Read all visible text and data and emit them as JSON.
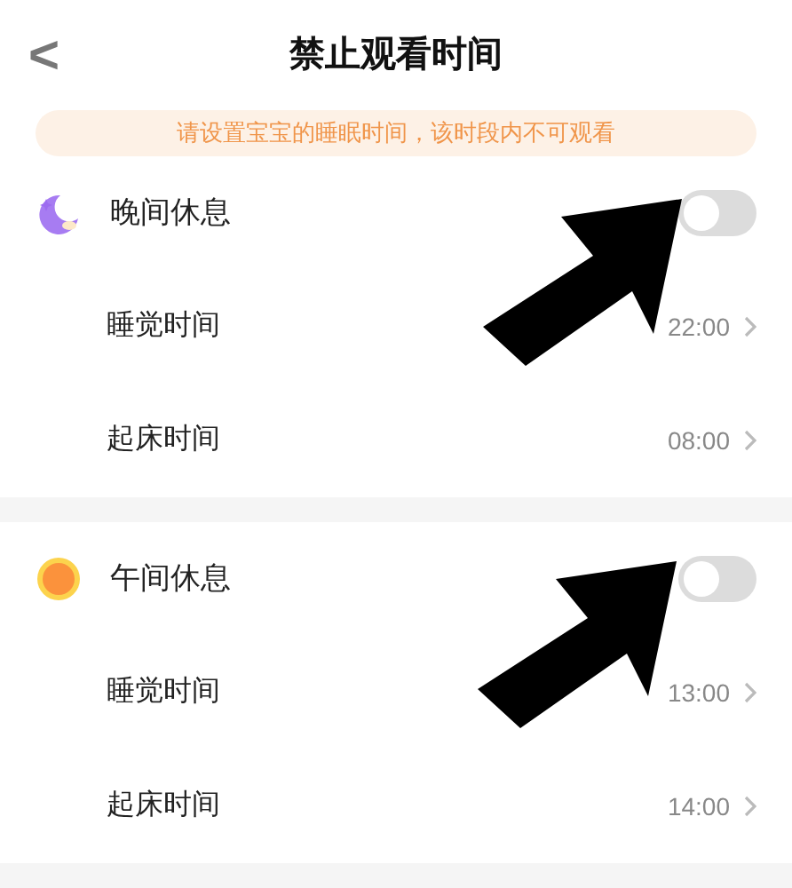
{
  "header": {
    "back": "<",
    "title": "禁止观看时间"
  },
  "notice": "请设置宝宝的睡眠时间，该时段内不可观看",
  "sections": [
    {
      "kind": "night",
      "title": "晚间休息",
      "on": false,
      "rows": [
        {
          "label": "睡觉时间",
          "value": "22:00"
        },
        {
          "label": "起床时间",
          "value": "08:00"
        }
      ]
    },
    {
      "kind": "noon",
      "title": "午间休息",
      "on": false,
      "rows": [
        {
          "label": "睡觉时间",
          "value": "13:00"
        },
        {
          "label": "起床时间",
          "value": "14:00"
        }
      ]
    }
  ]
}
